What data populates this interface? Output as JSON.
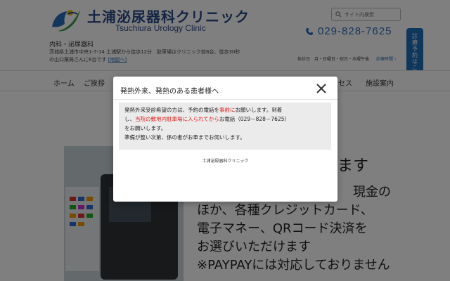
{
  "header": {
    "logo_title": "土浦泌尿器科クリニック",
    "logo_subtitle": "Tsuchiura Urology Clinic",
    "departments": "内科・泌尿器科",
    "address_line1": "茨城県土浦市中央1-7-14 土浦駅から徒歩12分　駐車場はクリニック前8台、徒歩30秒",
    "address_line2": "の山口薬局さんに6台です",
    "address_link": "[地図へ]",
    "search_placeholder": "サイト内検索",
    "phone": "029-828-7625",
    "hours": "休診日　月・日曜日・祝日・水曜午後",
    "hours_link": "診療時間",
    "side_tab": "診療予約はこちら"
  },
  "nav": {
    "items": [
      "ホーム",
      "ご挨拶",
      "セス",
      "施設案内"
    ]
  },
  "content": {
    "heading_tail": "ます",
    "payment_lines": [
      "現金の",
      "ほか、各種クレジットカード、",
      "電子マネー、QRコード決済を",
      "お選びいただけます",
      "※PAYPAYには対応しておりません"
    ]
  },
  "modal": {
    "title": "発熱外来、発熱のある患者様へ",
    "notice": {
      "line1_a": "発熱外来受診希望の方は、予約の電話を",
      "line1_red": "事前に",
      "line1_b": "お願いします。到着",
      "line2_a": "し、",
      "line2_red": "当院の敷地内駐車場に入られてから",
      "line2_b": "お電話（029－828－7625）",
      "line3": "をお願いします。",
      "line4": "準備が整い次第、係の者がお車までお伺いします。"
    },
    "footer": "土浦泌尿器科クリニック"
  },
  "colors": {
    "brand": "#2b4a87",
    "accent": "#1f6db6",
    "alert": "#e02020"
  }
}
